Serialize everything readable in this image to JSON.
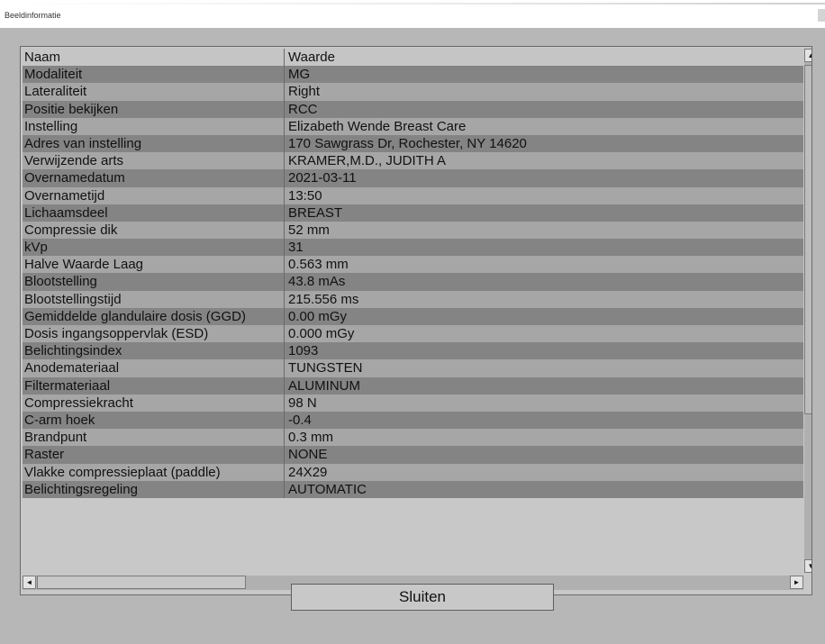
{
  "window": {
    "title": "Beeldinformatie"
  },
  "table": {
    "columns": [
      "Naam",
      "Waarde"
    ],
    "rows": [
      [
        "Modaliteit",
        "MG"
      ],
      [
        "Lateraliteit",
        "Right"
      ],
      [
        "Positie bekijken",
        "RCC"
      ],
      [
        "Instelling",
        "Elizabeth Wende Breast Care"
      ],
      [
        "Adres van instelling",
        "170 Sawgrass Dr, Rochester, NY 14620"
      ],
      [
        "Verwijzende arts",
        "KRAMER,M.D., JUDITH A"
      ],
      [
        "Overnamedatum",
        "2021-03-11"
      ],
      [
        "Overnametijd",
        "13:50"
      ],
      [
        "Lichaamsdeel",
        "BREAST"
      ],
      [
        "Compressie dik",
        "52 mm"
      ],
      [
        "kVp",
        "31"
      ],
      [
        "Halve Waarde Laag",
        "0.563 mm"
      ],
      [
        "Blootstelling",
        "43.8  mAs"
      ],
      [
        "Blootstellingstijd",
        "215.556 ms"
      ],
      [
        "Gemiddelde glandulaire dosis (GGD)",
        "0.00 mGy"
      ],
      [
        "Dosis ingangsoppervlak (ESD)",
        "0.000 mGy"
      ],
      [
        "Belichtingsindex",
        "1093"
      ],
      [
        "Anodemateriaal",
        "TUNGSTEN"
      ],
      [
        "Filtermateriaal",
        "ALUMINUM"
      ],
      [
        "Compressiekracht",
        "98 N"
      ],
      [
        "C-arm hoek",
        "-0.4"
      ],
      [
        "Brandpunt",
        "0.3 mm"
      ],
      [
        "Raster",
        "NONE"
      ],
      [
        "Vlakke compressieplaat (paddle)",
        "24X29"
      ],
      [
        "Belichtingsregeling",
        "AUTOMATIC"
      ]
    ]
  },
  "scrollbars": {
    "up_icon": "arrow-up-icon",
    "down_icon": "arrow-down-icon",
    "left_icon": "arrow-left-icon",
    "right_icon": "arrow-right-icon"
  },
  "buttons": {
    "close_label": "Sluiten"
  }
}
